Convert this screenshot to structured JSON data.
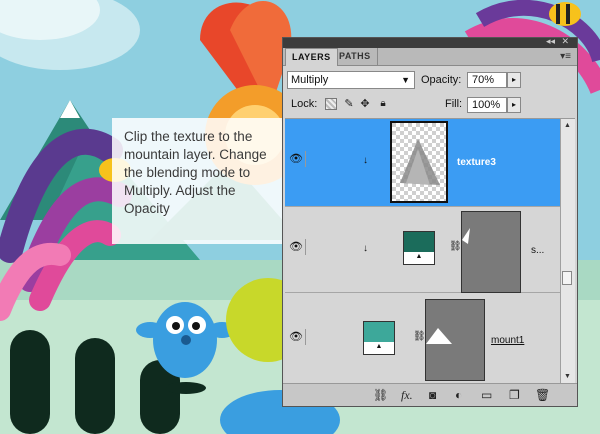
{
  "callout": {
    "text": "Clip the texture to the mountain layer. Change the blending mode to Multiply. Adjust the Opacity"
  },
  "panel": {
    "collapse_glyph": "◂◂",
    "close_glyph": "✕",
    "menu_glyph": "▾≡",
    "tabs": [
      {
        "label": "LAYERS"
      },
      {
        "label": "PATHS"
      }
    ],
    "blend_mode": "Multiply",
    "opacity_label": "Opacity:",
    "opacity_value": "70%",
    "lock_label": "Lock:",
    "fill_label": "Fill:",
    "fill_value": "100%",
    "layers": [
      {
        "name": "texture3",
        "selected": true,
        "clipped": true,
        "visible": true
      },
      {
        "name": "s...",
        "selected": false,
        "clipped": true,
        "visible": true
      },
      {
        "name": "mount1",
        "selected": false,
        "clipped": false,
        "visible": true
      }
    ],
    "bottom_icons": [
      "link-icon",
      "fx-icon",
      "mask-icon",
      "adjustment-icon",
      "folder-icon",
      "new-layer-icon",
      "trash-icon"
    ]
  },
  "colors": {
    "selection": "#3b9cf3",
    "panel_bg": "#d4d4d4",
    "swatch_teal": "#1b6c5b",
    "swatch_aqua": "#3da89a"
  }
}
